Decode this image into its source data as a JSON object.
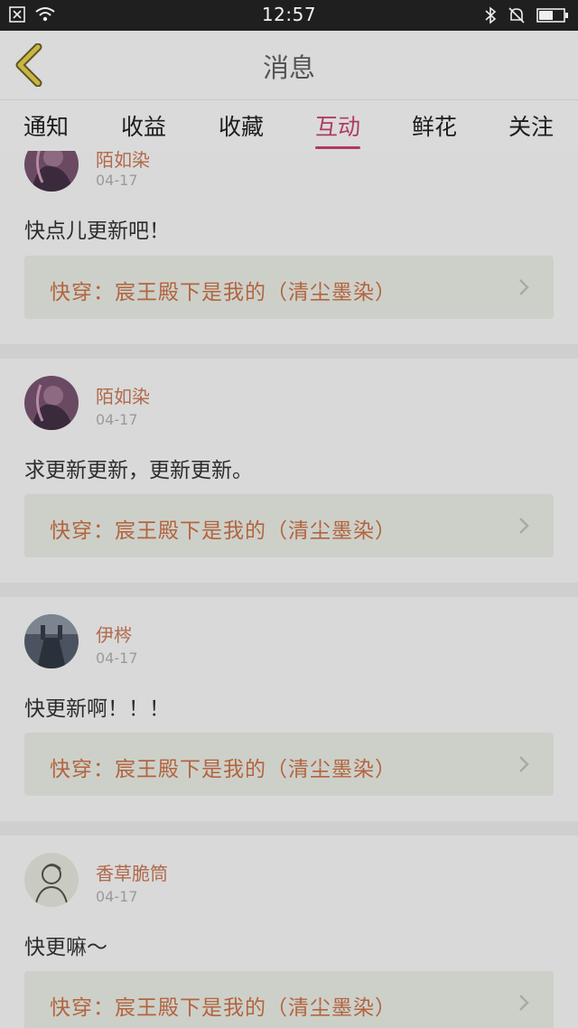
{
  "status": {
    "time": "12:57"
  },
  "header": {
    "title": "消息"
  },
  "tabs": [
    {
      "label": "通知"
    },
    {
      "label": "收益"
    },
    {
      "label": "收藏"
    },
    {
      "label": "互动",
      "active": true
    },
    {
      "label": "鲜花"
    },
    {
      "label": "关注"
    }
  ],
  "messages": [
    {
      "user": "陌如染",
      "date": "04-17",
      "comment": "快点儿更新吧！",
      "book": "快穿：宸王殿下是我的（清尘墨染）"
    },
    {
      "user": "陌如染",
      "date": "04-17",
      "comment": "求更新更新，更新更新。",
      "book": "快穿：宸王殿下是我的（清尘墨染）"
    },
    {
      "user": "伊梣",
      "date": "04-17",
      "comment": "快更新啊！！！",
      "book": "快穿：宸王殿下是我的（清尘墨染）"
    },
    {
      "user": "香草脆筒",
      "date": "04-17",
      "comment": "快更嘛～",
      "book": "快穿：宸王殿下是我的（清尘墨染）"
    }
  ],
  "colors": {
    "accent": "#b03a5e",
    "name": "#b06a4a",
    "book": "#b3643f",
    "back": "#b8a53a"
  }
}
